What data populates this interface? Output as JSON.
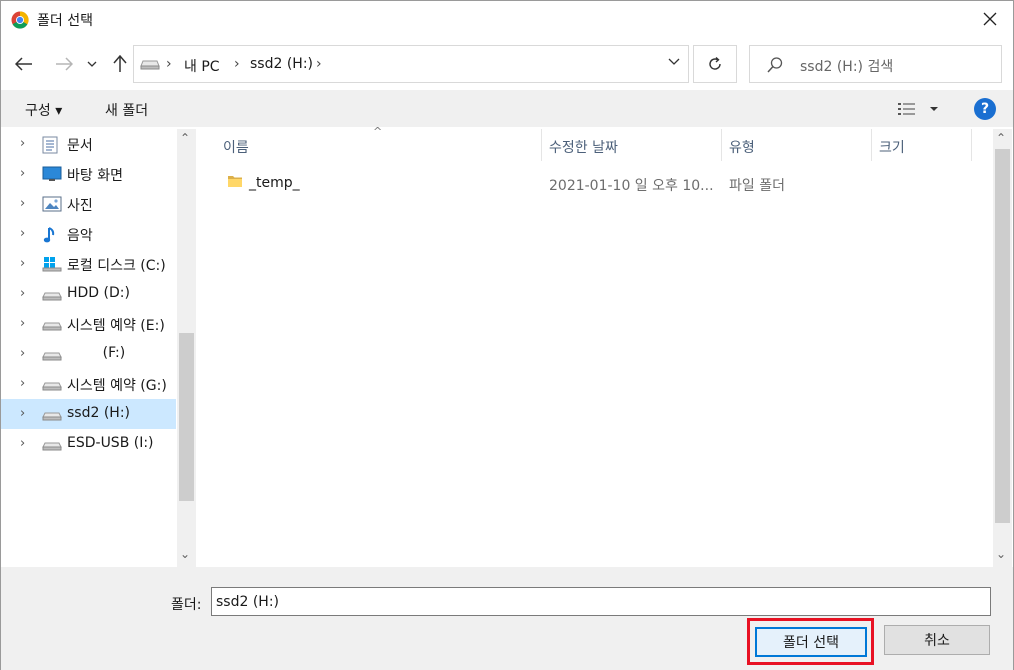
{
  "window": {
    "title": "폴더 선택",
    "close_icon": "close-icon"
  },
  "nav": {
    "back_icon": "back-arrow-icon",
    "forward_icon": "forward-arrow-icon",
    "recent_icon": "chevron-down-icon",
    "up_icon": "up-arrow-icon",
    "breadcrumbs": [
      "내 PC",
      "ssd2 (H:)"
    ],
    "refresh_icon": "refresh-icon",
    "search_placeholder": "ssd2 (H:) 검색"
  },
  "toolbar": {
    "organize": "구성 ▾",
    "new_folder": "새 폴더",
    "view_icon": "view-options-icon",
    "help": "?"
  },
  "tree": [
    {
      "label": "문서",
      "icon": "documents-icon"
    },
    {
      "label": "바탕 화면",
      "icon": "desktop-icon"
    },
    {
      "label": "사진",
      "icon": "pictures-icon"
    },
    {
      "label": "음악",
      "icon": "music-icon"
    },
    {
      "label": "로컬 디스크 (C:)",
      "icon": "windows-drive-icon"
    },
    {
      "label": "HDD (D:)",
      "icon": "drive-icon"
    },
    {
      "label": "시스템 예약 (E:)",
      "icon": "drive-icon"
    },
    {
      "label": "        (F:)",
      "icon": "drive-icon"
    },
    {
      "label": "시스템 예약 (G:)",
      "icon": "drive-icon"
    },
    {
      "label": "ssd2 (H:)",
      "icon": "drive-icon",
      "selected": true
    },
    {
      "label": "ESD-USB (I:)",
      "icon": "drive-icon"
    }
  ],
  "columns": [
    "이름",
    "수정한 날짜",
    "유형",
    "크기"
  ],
  "files": [
    {
      "name": "_temp_",
      "modified": "2021-01-10 일 오후 10...",
      "type": "파일 폴더",
      "size": ""
    }
  ],
  "bottom": {
    "folder_label": "폴더:",
    "folder_value": "ssd2 (H:)",
    "select_button": "폴더 선택",
    "cancel_button": "취소"
  },
  "colors": {
    "highlight_box": "#e81123",
    "selected_row": "#cce8ff",
    "accent": "#0078d7"
  }
}
